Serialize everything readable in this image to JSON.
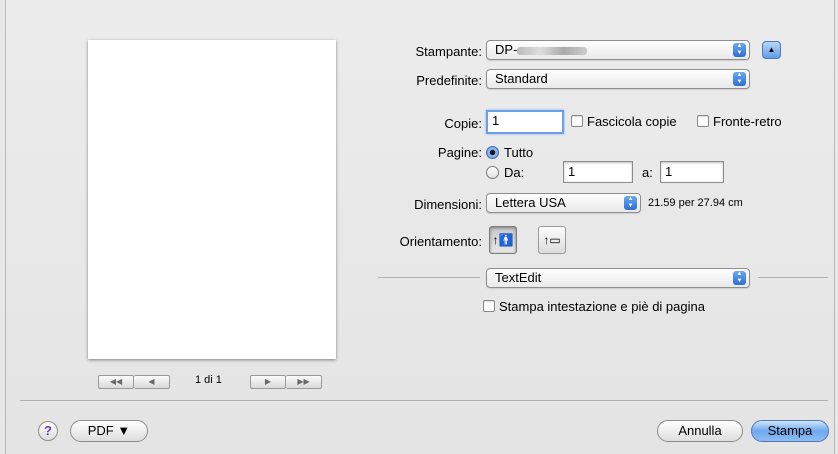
{
  "preview": {
    "page_count": "1 di 1"
  },
  "printer": {
    "label": "Stampante:",
    "value": "DP-"
  },
  "presets": {
    "label": "Predefinite:",
    "value": "Standard"
  },
  "copies": {
    "label": "Copie:",
    "value": "1",
    "collate_label": "Fascicola copie",
    "duplex_label": "Fronte-retro"
  },
  "pages": {
    "label": "Pagine:",
    "all_label": "Tutto",
    "from_label": "Da:",
    "from_value": "1",
    "to_label": "a:",
    "to_value": "1"
  },
  "paper_size": {
    "label": "Dimensioni:",
    "value": "Lettera USA",
    "dimensions": "21.59 per 27.94 cm"
  },
  "orientation": {
    "label": "Orientamento:"
  },
  "app_section": {
    "value": "TextEdit",
    "header_footer_label": "Stampa intestazione e piè di pagina"
  },
  "footer": {
    "help": "?",
    "pdf_label": "PDF ▼",
    "cancel_label": "Annulla",
    "print_label": "Stampa"
  },
  "colors": {
    "accent": "#5f9de9"
  }
}
